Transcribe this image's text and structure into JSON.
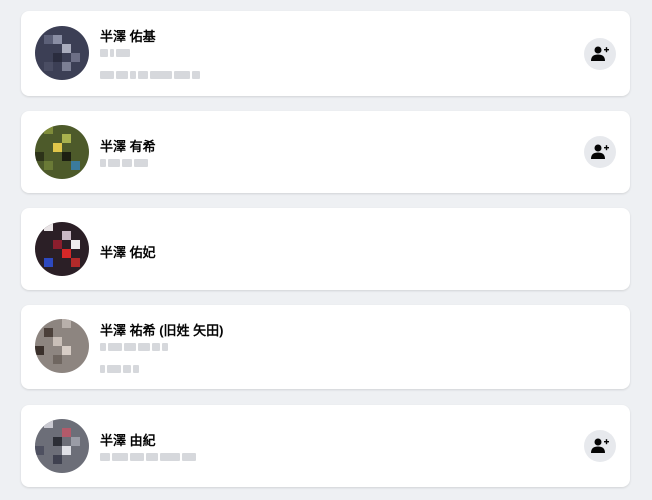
{
  "people": [
    {
      "name": "半澤 佑基",
      "has_add": true
    },
    {
      "name": "半澤 有希",
      "has_add": true
    },
    {
      "name": "半澤 佑妃",
      "has_add": false
    },
    {
      "name": "半澤 祐希 (旧姓 矢田)",
      "has_add": false
    },
    {
      "name": "半澤 由紀",
      "has_add": true
    }
  ],
  "icons": {
    "add_friend": "add-friend-icon"
  },
  "colors": {
    "background": "#eef0f3",
    "card": "#ffffff",
    "button": "#e7e9ed",
    "text": "#050505"
  }
}
